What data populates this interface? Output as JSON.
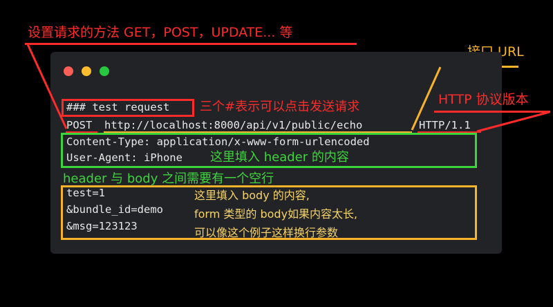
{
  "colors": {
    "background": "#000000",
    "window": "#222326",
    "code_text": "#e8e8e8",
    "annotation_red": "#ff2b2b",
    "annotation_orange": "#f7b42a",
    "annotation_green": "#3ed43e",
    "annotation_yellow": "#f5d36a",
    "dot_red": "#ff5f57",
    "dot_yellow": "#febc2e",
    "dot_green": "#28c840"
  },
  "annotations": {
    "method": "设置请求的方法 GET，POST，UPDATE... 等",
    "url": "接口 URL",
    "http_version": "HTTP 协议版本",
    "hash_note": "三个#表示可以点击发送请求",
    "header_note": "这里填入 header 的内容",
    "blank_line_note": "header 与 body 之间需要有一个空行",
    "body_note_1": "这里填入 body 的内容,",
    "body_note_2": "form 类型的 body如果内容太长,",
    "body_note_3": "可以像这个例子这样换行参数"
  },
  "code": {
    "title_line": "### test request",
    "method": "POST",
    "url": "http://localhost:8000/api/v1/public/echo",
    "version": "HTTP/1.1",
    "header_1": "Content-Type: application/x-www-form-urlencoded",
    "header_2": "User-Agent: iPhone",
    "body_1": "test=1",
    "body_2": "&bundle_id=demo",
    "body_3": "&msg=123123"
  }
}
